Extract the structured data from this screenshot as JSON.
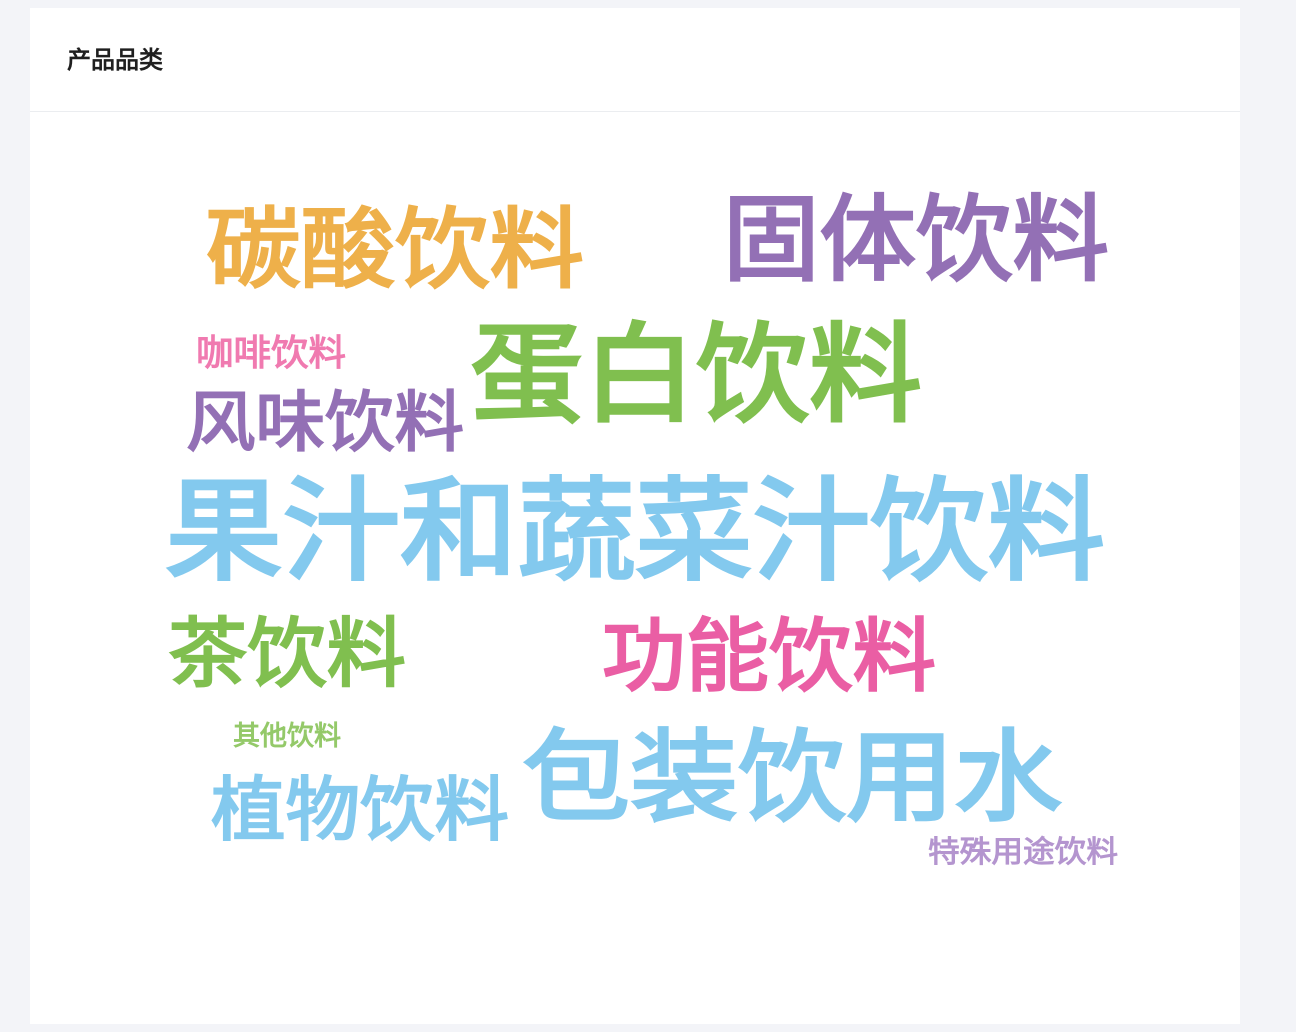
{
  "card": {
    "title": "产品品类"
  },
  "chart_data": {
    "type": "wordcloud",
    "words": [
      {
        "text": "果汁和蔬菜汁饮料",
        "color": "#83c9ee"
      },
      {
        "text": "包装饮用水",
        "color": "#83c9ee"
      },
      {
        "text": "蛋白饮料",
        "color": "#80bf4f"
      },
      {
        "text": "固体饮料",
        "color": "#9370b5"
      },
      {
        "text": "碳酸饮料",
        "color": "#eeb04a"
      },
      {
        "text": "功能饮料",
        "color": "#ea5ea4"
      },
      {
        "text": "风味饮料",
        "color": "#9370b5"
      },
      {
        "text": "植物饮料",
        "color": "#83c9ee"
      },
      {
        "text": "茶饮料",
        "color": "#80bf4f"
      },
      {
        "text": "咖啡饮料",
        "color": "#f07ab0"
      },
      {
        "text": "其他饮料",
        "color": "#94c969"
      },
      {
        "text": "特殊用途饮料",
        "color": "#b495cf"
      }
    ]
  }
}
